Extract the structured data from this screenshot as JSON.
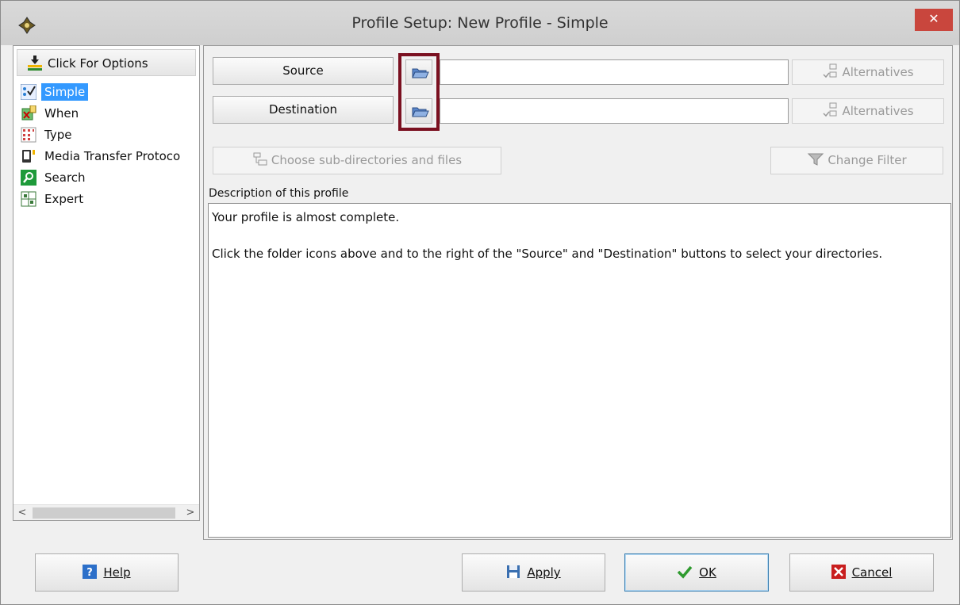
{
  "window": {
    "title": "Profile Setup: New Profile - Simple",
    "close_label": "✕"
  },
  "sidebar": {
    "options_label": "Click For Options",
    "items": [
      {
        "label": "Simple",
        "icon": "simple-check-icon"
      },
      {
        "label": "When",
        "icon": "when-calendar-icon"
      },
      {
        "label": "Type",
        "icon": "type-grid-icon"
      },
      {
        "label": "Media Transfer Protoco",
        "icon": "device-icon"
      },
      {
        "label": "Search",
        "icon": "search-icon"
      },
      {
        "label": "Expert",
        "icon": "expert-grid-icon"
      }
    ],
    "selected_index": 0,
    "scroll_left": "<",
    "scroll_right": ">"
  },
  "paths": {
    "source_label": "Source",
    "destination_label": "Destination",
    "source_value": "",
    "destination_value": "",
    "alternatives_label": "Alternatives",
    "choose_subdirs_label": "Choose sub-directories and files",
    "change_filter_label": "Change Filter"
  },
  "description": {
    "group_label": "Description of this profile",
    "line1": "Your profile is almost complete.",
    "line2": "Click the folder icons above and to the right of the \"Source\" and \"Destination\" buttons to select your directories."
  },
  "footer": {
    "help_label": "Help",
    "apply_label": "Apply",
    "ok_label": "OK",
    "cancel_label": "Cancel"
  },
  "colors": {
    "selection": "#3399ff",
    "highlight_box": "#7a1020",
    "close_button": "#c9463d"
  }
}
